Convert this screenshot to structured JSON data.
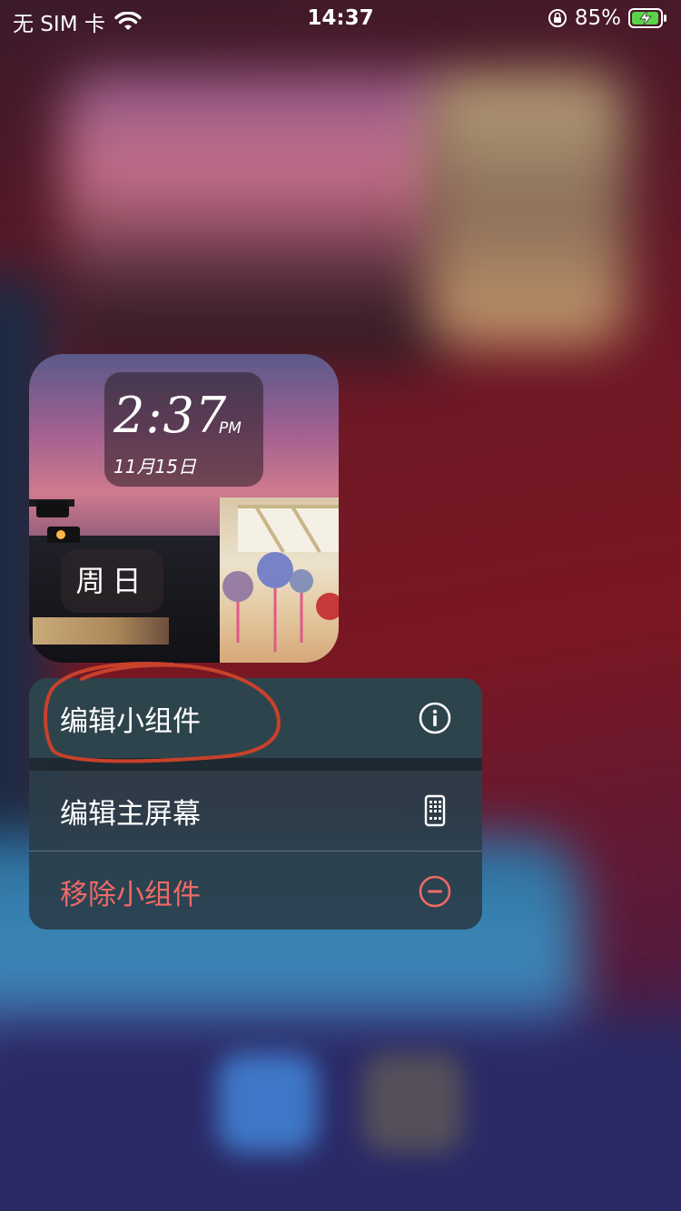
{
  "status_bar": {
    "carrier": "无 SIM 卡",
    "time": "14:37",
    "battery_percent": "85%",
    "battery_state": "charging",
    "icons": [
      "wifi-icon",
      "orientation-lock-icon",
      "battery-charging-icon"
    ]
  },
  "widget": {
    "clock_time": "2:37",
    "clock_ampm": "PM",
    "clock_date": "11月15日",
    "weekday": "周日"
  },
  "context_menu": {
    "items": [
      {
        "label": "编辑小组件",
        "icon": "info-icon"
      },
      {
        "label": "编辑主屏幕",
        "icon": "phone-icon"
      },
      {
        "label": "移除小组件",
        "icon": "minus-circle-icon",
        "color": "#ef6a66"
      }
    ]
  },
  "annotation": {
    "type": "hand-drawn circle",
    "color": "#c8412a"
  }
}
